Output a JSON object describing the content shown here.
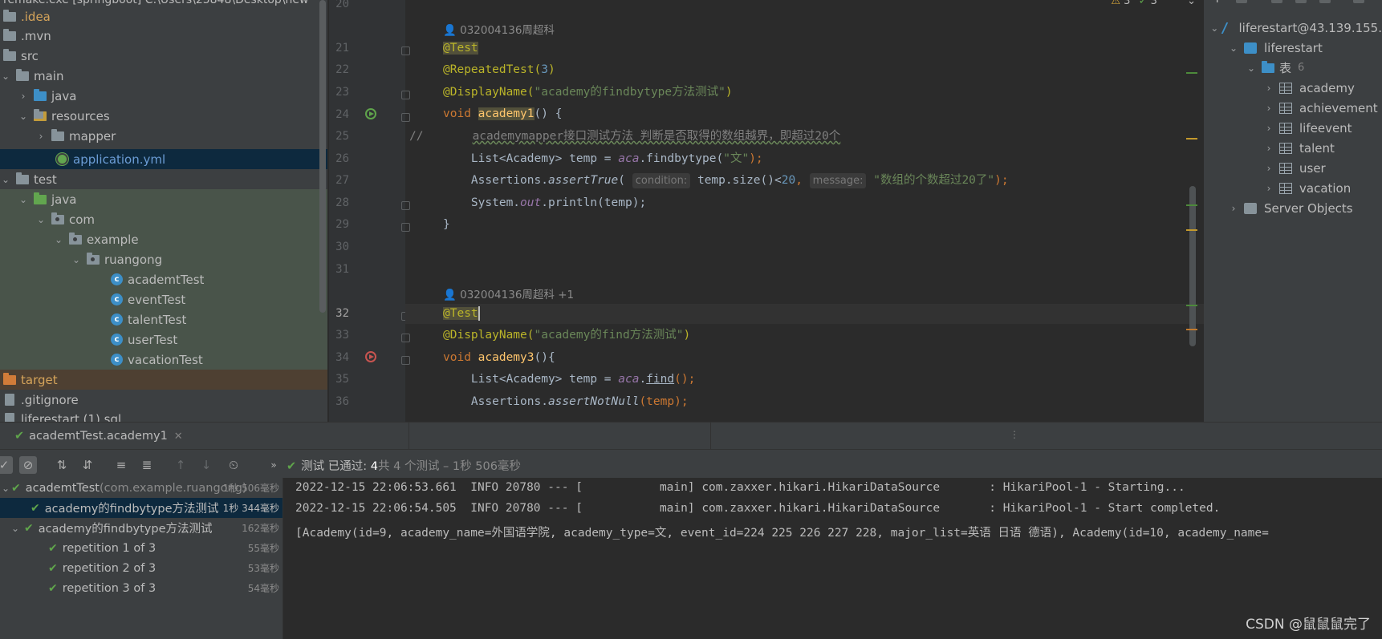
{
  "project": {
    "title": "remake.exe [springboot] C:\\Users\\25848\\Desktop\\new",
    "items": [
      {
        "label": ".idea"
      },
      {
        "label": ".mvn"
      },
      {
        "label": "src"
      },
      {
        "label": "main"
      },
      {
        "label": "java"
      },
      {
        "label": "resources"
      },
      {
        "label": "mapper"
      },
      {
        "label": "application.yml"
      },
      {
        "label": "test"
      },
      {
        "label": "java"
      },
      {
        "label": "com"
      },
      {
        "label": "example"
      },
      {
        "label": "ruangong"
      },
      {
        "label": "academtTest"
      },
      {
        "label": "eventTest"
      },
      {
        "label": "talentTest"
      },
      {
        "label": "userTest"
      },
      {
        "label": "vacationTest"
      },
      {
        "label": "target"
      },
      {
        "label": ".gitignore"
      },
      {
        "label": "liferestart (1).sql"
      }
    ]
  },
  "editor": {
    "warnings": "3",
    "checks": "3",
    "line_numbers": [
      "20",
      "21",
      "22",
      "23",
      "24",
      "25",
      "26",
      "27",
      "28",
      "29",
      "30",
      "31",
      "32",
      "33",
      "34",
      "35",
      "36"
    ],
    "author1": "032004136周超科",
    "author2": "032004136周超科 +1",
    "code": {
      "l21": "@Test",
      "l22_a": "@RepeatedTest(",
      "l22_num": "3",
      "l22_b": ")",
      "l23_a": "@DisplayName(",
      "l23_str": "\"academy的findbytype方法测试\"",
      "l23_b": ")",
      "l24_kw": "void ",
      "l24_fn": "academy1",
      "l24_b": "() {",
      "l25_a": "//       ",
      "l25_b": "academymapper接口测试方法 判断是否取得的数组越界，即超过20个",
      "l26_a": "    List<Academy> temp = ",
      "l26_field": "aca",
      "l26_b": ".findbytype(",
      "l26_str": "\"文\"",
      "l26_c": ");",
      "l27_a": "    Assertions.",
      "l27_fn": "assertTrue",
      "l27_b": "( ",
      "l27_hint1": "condition:",
      "l27_c": " temp.size()<",
      "l27_num": "20",
      "l27_d": ", ",
      "l27_hint2": "message:",
      "l27_str": " \"数组的个数超过20了\"",
      "l27_e": ");",
      "l28_a": "    System.",
      "l28_field": "out",
      "l28_b": ".println(temp);",
      "l29": "}",
      "l32": "@Test",
      "l33_a": "@DisplayName(",
      "l33_str": "\"academy的find方法测试\"",
      "l33_b": ")",
      "l34_kw": "void ",
      "l34_fn": "academy3",
      "l34_b": "(){",
      "l35_a": "    List<Academy> temp = ",
      "l35_field": "aca",
      "l35_b": ".",
      "l35_c": "find",
      "l35_d": "();",
      "l36_a": "    Assertions.",
      "l36_fn": "assertNotNull",
      "l36_b": "(temp);"
    }
  },
  "database": {
    "items": [
      {
        "label": "liferestart@43.139.155."
      },
      {
        "label": "liferestart"
      },
      {
        "label": "表",
        "count": "6"
      },
      {
        "label": "academy"
      },
      {
        "label": "achievement"
      },
      {
        "label": "lifeevent"
      },
      {
        "label": "talent"
      },
      {
        "label": "user"
      },
      {
        "label": "vacation"
      },
      {
        "label": "Server Objects"
      }
    ]
  },
  "run": {
    "tab_label": "academtTest.academy1",
    "status_prefix": "测试 已通过: ",
    "status_count": "4",
    "status_suffix": "共 4 个测试 – 1秒 506毫秒",
    "tree": [
      {
        "label": "academtTest",
        "pkg": " (com.example.ruangong)",
        "duration": "1秒 506毫秒"
      },
      {
        "label": "academy的findbytype方法测试",
        "duration": "1秒 344毫秒"
      },
      {
        "label": "academy的findbytype方法测试",
        "duration": "162毫秒"
      },
      {
        "label": "repetition 1 of 3",
        "duration": "55毫秒"
      },
      {
        "label": "repetition 2 of 3",
        "duration": "53毫秒"
      },
      {
        "label": "repetition 3 of 3",
        "duration": "54毫秒"
      }
    ],
    "console": [
      "2022-12-15 22:06:53.661  INFO 20780 --- [           main] com.zaxxer.hikari.HikariDataSource       : HikariPool-1 - Starting...",
      "2022-12-15 22:06:54.505  INFO 20780 --- [           main] com.zaxxer.hikari.HikariDataSource       : HikariPool-1 - Start completed.",
      "[Academy(id=9, academy_name=外国语学院, academy_type=文, event_id=224 225 226 227 228, major_list=英语 日语 德语), Academy(id=10, academy_name="
    ]
  },
  "watermark": "CSDN @鼠鼠鼠完了"
}
